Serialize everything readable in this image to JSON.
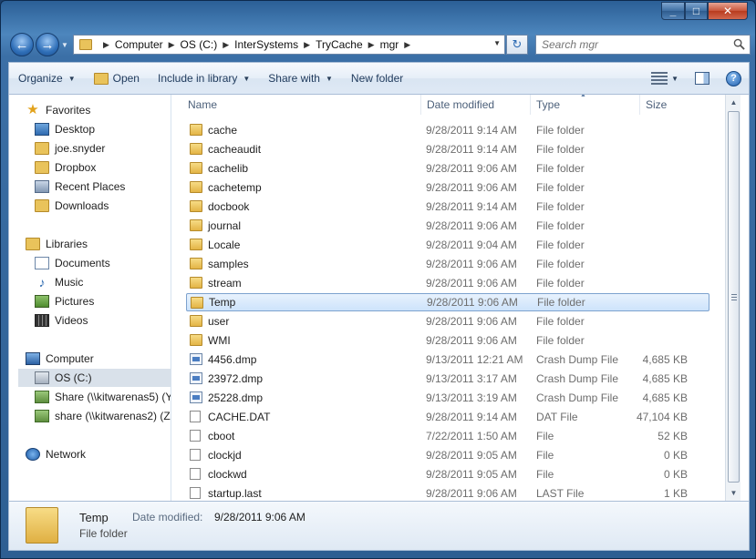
{
  "window": {
    "caption": {
      "minimize": "_",
      "maximize": "□",
      "close": "✕"
    }
  },
  "address": {
    "breadcrumbs": [
      "Computer",
      "OS (C:)",
      "InterSystems",
      "TryCache",
      "mgr"
    ],
    "search_placeholder": "Search mgr"
  },
  "toolbar": {
    "organize": "Organize",
    "open": "Open",
    "include_in_library": "Include in library",
    "share_with": "Share with",
    "new_folder": "New folder"
  },
  "nav": {
    "favorites": "Favorites",
    "desktop": "Desktop",
    "joe": "joe.snyder",
    "dropbox": "Dropbox",
    "recent": "Recent Places",
    "downloads": "Downloads",
    "libraries": "Libraries",
    "documents": "Documents",
    "music": "Music",
    "pictures": "Pictures",
    "videos": "Videos",
    "computer": "Computer",
    "os_c": "OS (C:)",
    "share5": "Share (\\\\kitwarenas5) (Y",
    "share2": "share (\\\\kitwarenas2) (Z:",
    "network": "Network"
  },
  "columns": {
    "name": "Name",
    "date": "Date modified",
    "type": "Type",
    "size": "Size"
  },
  "files": [
    {
      "name": "cache",
      "date": "9/28/2011 9:14 AM",
      "type": "File folder",
      "size": "",
      "kind": "folder"
    },
    {
      "name": "cacheaudit",
      "date": "9/28/2011 9:14 AM",
      "type": "File folder",
      "size": "",
      "kind": "folder"
    },
    {
      "name": "cachelib",
      "date": "9/28/2011 9:06 AM",
      "type": "File folder",
      "size": "",
      "kind": "folder"
    },
    {
      "name": "cachetemp",
      "date": "9/28/2011 9:06 AM",
      "type": "File folder",
      "size": "",
      "kind": "folder"
    },
    {
      "name": "docbook",
      "date": "9/28/2011 9:14 AM",
      "type": "File folder",
      "size": "",
      "kind": "folder"
    },
    {
      "name": "journal",
      "date": "9/28/2011 9:06 AM",
      "type": "File folder",
      "size": "",
      "kind": "folder"
    },
    {
      "name": "Locale",
      "date": "9/28/2011 9:04 AM",
      "type": "File folder",
      "size": "",
      "kind": "folder"
    },
    {
      "name": "samples",
      "date": "9/28/2011 9:06 AM",
      "type": "File folder",
      "size": "",
      "kind": "folder"
    },
    {
      "name": "stream",
      "date": "9/28/2011 9:06 AM",
      "type": "File folder",
      "size": "",
      "kind": "folder"
    },
    {
      "name": "Temp",
      "date": "9/28/2011 9:06 AM",
      "type": "File folder",
      "size": "",
      "kind": "folder"
    },
    {
      "name": "user",
      "date": "9/28/2011 9:06 AM",
      "type": "File folder",
      "size": "",
      "kind": "folder"
    },
    {
      "name": "WMI",
      "date": "9/28/2011 9:06 AM",
      "type": "File folder",
      "size": "",
      "kind": "folder"
    },
    {
      "name": "4456.dmp",
      "date": "9/13/2011 12:21 AM",
      "type": "Crash Dump File",
      "size": "4,685 KB",
      "kind": "dump"
    },
    {
      "name": "23972.dmp",
      "date": "9/13/2011 3:17 AM",
      "type": "Crash Dump File",
      "size": "4,685 KB",
      "kind": "dump"
    },
    {
      "name": "25228.dmp",
      "date": "9/13/2011 3:19 AM",
      "type": "Crash Dump File",
      "size": "4,685 KB",
      "kind": "dump"
    },
    {
      "name": "CACHE.DAT",
      "date": "9/28/2011 9:14 AM",
      "type": "DAT File",
      "size": "47,104 KB",
      "kind": "file"
    },
    {
      "name": "cboot",
      "date": "7/22/2011 1:50 AM",
      "type": "File",
      "size": "52 KB",
      "kind": "file"
    },
    {
      "name": "clockjd",
      "date": "9/28/2011 9:05 AM",
      "type": "File",
      "size": "0 KB",
      "kind": "file"
    },
    {
      "name": "clockwd",
      "date": "9/28/2011 9:05 AM",
      "type": "File",
      "size": "0 KB",
      "kind": "file"
    },
    {
      "name": "startup.last",
      "date": "9/28/2011 9:06 AM",
      "type": "LAST File",
      "size": "1 KB",
      "kind": "file"
    }
  ],
  "details": {
    "name": "Temp",
    "type": "File folder",
    "date_label": "Date modified:",
    "date_value": "9/28/2011 9:06 AM"
  }
}
